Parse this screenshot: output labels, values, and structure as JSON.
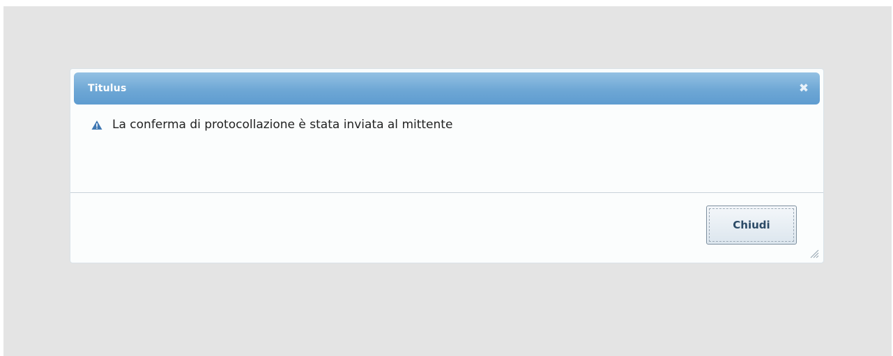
{
  "dialog": {
    "title": "Titulus",
    "close_icon": "close-icon",
    "message_icon": "warning-icon",
    "message": "La conferma di protocollazione è stata inviata al mittente",
    "button_label": "Chiudi",
    "resize_icon": "resize-grip-icon"
  },
  "colors": {
    "titlebar": "#6ea7d5",
    "backdrop": "#e4e4e4",
    "dialog_bg": "#fbfdfd",
    "warning_icon": "#3f78b3",
    "button_text": "#2b4a66"
  }
}
